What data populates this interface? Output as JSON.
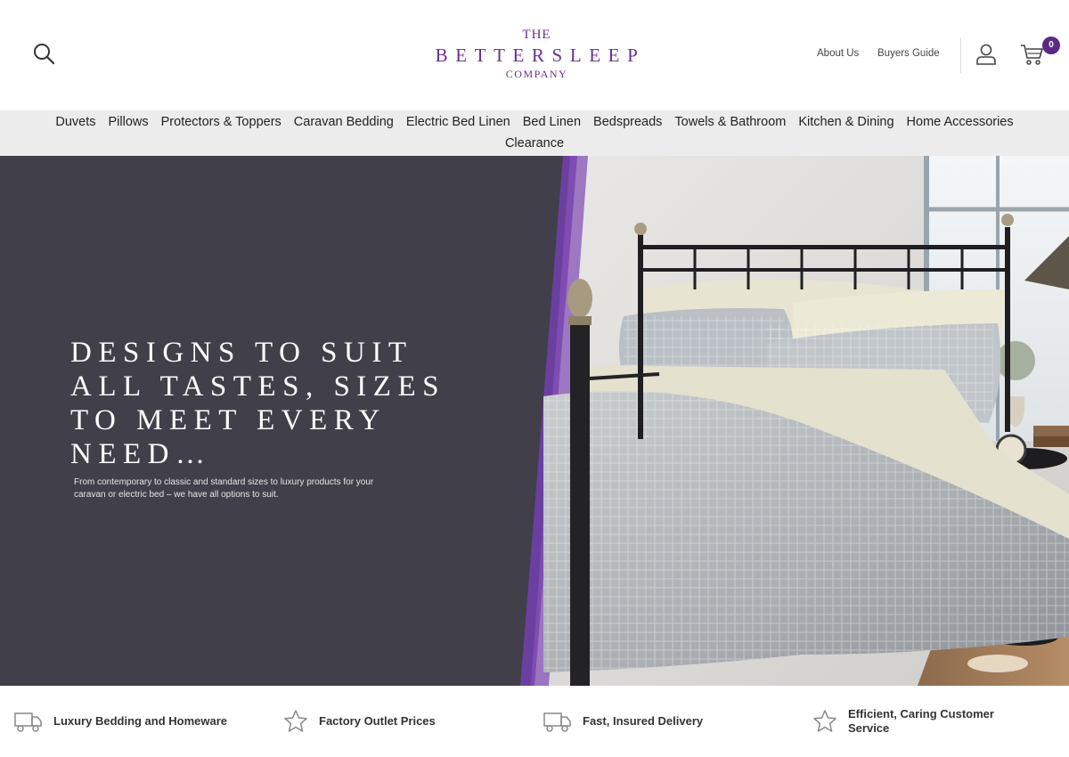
{
  "brand": {
    "line1": "THE",
    "line2": "BETTERSLEEP",
    "line3": "COMPANY",
    "color": "#6b2f8f"
  },
  "header": {
    "search_icon": "search-icon",
    "links": [
      "About Us",
      "Buyers Guide"
    ],
    "account_icon": "user-icon",
    "cart_icon": "cart-icon",
    "cart_count": "0",
    "badge_color": "#5b2a86"
  },
  "nav": {
    "items": [
      "Duvets",
      "Pillows",
      "Protectors & Toppers",
      "Caravan Bedding",
      "Electric Bed Linen",
      "Bed Linen",
      "Bedspreads",
      "Towels & Bathroom",
      "Kitchen & Dining",
      "Home Accessories",
      "Clearance"
    ]
  },
  "hero": {
    "title": "DESIGNS TO SUIT ALL TASTES, SIZES TO MEET EVERY NEED…",
    "subtitle": "From contemporary to classic and standard sizes to luxury products for your caravan or electric bed – we have all options to suit.",
    "background": "#413f49",
    "accent": "#6b3fa0"
  },
  "features": [
    {
      "icon": "truck-icon",
      "label": "Luxury Bedding and Homeware"
    },
    {
      "icon": "star-icon",
      "label": "Factory Outlet Prices"
    },
    {
      "icon": "truck-icon",
      "label": "Fast, Insured Delivery"
    },
    {
      "icon": "star-icon",
      "label": "Efficient, Caring Customer Service"
    }
  ]
}
